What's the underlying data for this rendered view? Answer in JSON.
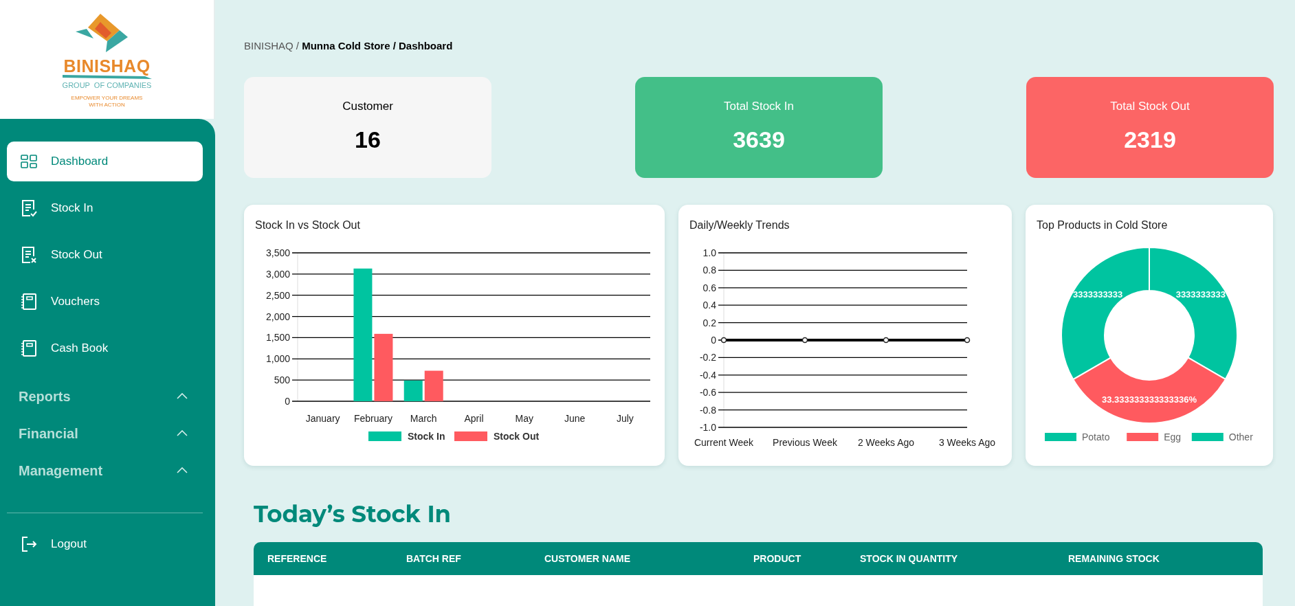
{
  "logo": {
    "name": "BINISHAQ",
    "subtitle": "GROUP  OF COMPANIES",
    "tagline": [
      "EMPOWER YOUR DREAMS",
      "WITH ACTION"
    ]
  },
  "sidebar": {
    "items": [
      {
        "label": "Dashboard",
        "kind": "dashboard",
        "selected": true
      },
      {
        "label": "Stock In",
        "kind": "stock-in",
        "selected": false
      },
      {
        "label": "Stock Out",
        "kind": "stock-out",
        "selected": false
      },
      {
        "label": "Vouchers",
        "kind": "book",
        "selected": false
      },
      {
        "label": "Cash Book",
        "kind": "book",
        "selected": false
      }
    ],
    "sections": [
      "Reports",
      "Financial",
      "Management"
    ],
    "logout": "Logout"
  },
  "breadcrumb": "BINISHAQ / **Munna Cold Store / Dashboard**",
  "stats": [
    {
      "label": "Customer",
      "value": "16",
      "color": "#f6f6f6"
    },
    {
      "label": "Total Stock In",
      "value": "3639",
      "color": "#43bf88"
    },
    {
      "label": "Total Stock Out",
      "value": "2319",
      "color": "#fc6565"
    }
  ],
  "charts": [
    {
      "title": "Stock In vs Stock Out",
      "chart_data": {
        "type": "bar",
        "categories": [
          "January",
          "February",
          "March",
          "April",
          "May",
          "June",
          "July"
        ],
        "series": [
          {
            "name": "Stock In",
            "color": "#00c4a0",
            "values": [
              0,
              3130,
              490,
              0,
              0,
              0,
              0
            ]
          },
          {
            "name": "Stock Out",
            "color": "#ff5a5f",
            "values": [
              0,
              1590,
              720,
              0,
              0,
              0,
              0
            ]
          }
        ],
        "grid": true,
        "legend": true,
        "ylim": [
          0,
          3500
        ],
        "yticks": [
          {
            "value": 0,
            "label": "0"
          },
          {
            "value": 500,
            "label": "500"
          },
          {
            "value": 1000,
            "label": "1,000"
          },
          {
            "value": 1500,
            "label": "1,500"
          },
          {
            "value": 2000,
            "label": "2,000"
          },
          {
            "value": 2500,
            "label": "2,500"
          },
          {
            "value": 3000,
            "label": "3,000"
          },
          {
            "value": 3500,
            "label": "3,500"
          }
        ]
      }
    },
    {
      "title": "Daily/Weekly Trends",
      "chart_data": {
        "type": "line",
        "categories": [
          "Current Week",
          "Previous Week",
          "2 Weeks Ago",
          "3 Weeks Ago"
        ],
        "series": [
          {
            "color": "#000000",
            "marker": "circle",
            "values": [
              0,
              0,
              0,
              0
            ]
          }
        ],
        "grid": true,
        "ylim": [
          -1,
          1
        ],
        "yticks": [
          {
            "value": -1,
            "label": "-1.0"
          },
          {
            "value": -0.8,
            "label": "-0.8"
          },
          {
            "value": -0.6,
            "label": "-0.6"
          },
          {
            "value": -0.4,
            "label": "-0.4"
          },
          {
            "value": -0.2,
            "label": "-0.2"
          },
          {
            "value": 0,
            "label": "0"
          },
          {
            "value": 0.2,
            "label": "0.2"
          },
          {
            "value": 0.4,
            "label": "0.4"
          },
          {
            "value": 0.6,
            "label": "0.6"
          },
          {
            "value": 0.8,
            "label": "0.8"
          },
          {
            "value": 1,
            "label": "1.0"
          }
        ]
      }
    },
    {
      "title": "Top Products in Cold Store",
      "chart_data": {
        "type": "donut",
        "categories": [
          "Potato",
          "Egg",
          "Other"
        ],
        "series": [
          {
            "values": [
              33.33,
              33.33,
              33.34
            ]
          }
        ],
        "legend": true,
        "colors": [
          "#00c4a0",
          "#ff5a5f",
          "#00c4a0"
        ],
        "value_labels": [
          "3333333333",
          "33.333333333333336%",
          "3333333333"
        ]
      }
    }
  ],
  "table": {
    "title": "Today’s Stock In",
    "columns": [
      "REFERENCE",
      "BATCH REF",
      "CUSTOMER NAME",
      "PRODUCT",
      "STOCK IN QUANTITY",
      "REMAINING STOCK"
    ]
  }
}
